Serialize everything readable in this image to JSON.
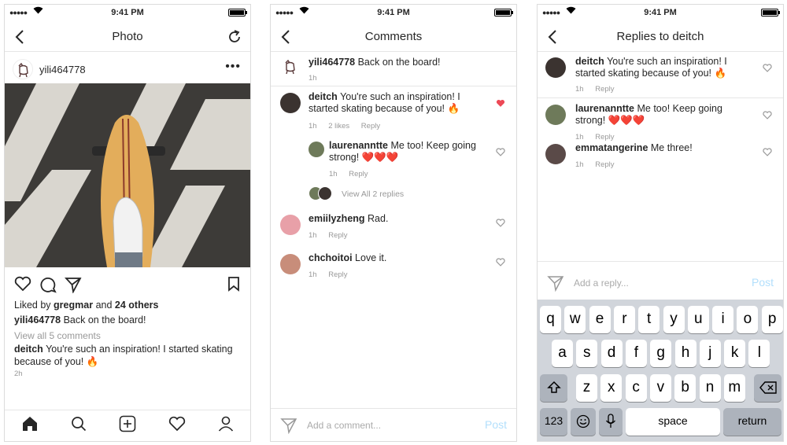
{
  "status": {
    "time": "9:41 PM"
  },
  "photo_screen": {
    "title": "Photo",
    "username": "yili464778",
    "liked_by_prefix": "Liked by",
    "liked_by_user": "gregmar",
    "liked_by_and": "and",
    "liked_by_others": "24 others",
    "caption_user": "yili464778",
    "caption_text": "Back on the board!",
    "view_all": "View all 5 comments",
    "comment_user": "deitch",
    "comment_text": "You're such an inspiration! I started skating because of you! 🔥",
    "time": "2h"
  },
  "comments_screen": {
    "title": "Comments",
    "caption": {
      "user": "yili464778",
      "text": "Back on the board!",
      "time": "1h"
    },
    "comments": [
      {
        "user": "deitch",
        "text": "You're such an inspiration! I started skating because of you! 🔥",
        "time": "1h",
        "likes": "2 likes",
        "reply": "Reply",
        "liked": true
      },
      {
        "user": "laurenanntte",
        "text": "Me too! Keep going strong! ❤️❤️❤️",
        "time": "1h",
        "reply": "Reply"
      },
      {
        "user": "emiilyzheng",
        "text": "Rad.",
        "time": "1h",
        "reply": "Reply"
      },
      {
        "user": "chchoitoi",
        "text": "Love it.",
        "time": "1h",
        "reply": "Reply"
      }
    ],
    "view_replies": "View All 2 replies",
    "input_placeholder": "Add a comment...",
    "post": "Post"
  },
  "replies_screen": {
    "title": "Replies to deitch",
    "replies": [
      {
        "user": "deitch",
        "text": "You're such an inspiration! I started skating because of you! 🔥",
        "time": "1h",
        "reply": "Reply"
      },
      {
        "user": "laurenanntte",
        "text": "Me too! Keep going strong! ❤️❤️❤️",
        "time": "1h",
        "reply": "Reply"
      },
      {
        "user": "emmatangerine",
        "text": "Me three!",
        "time": "1h",
        "reply": "Reply"
      }
    ],
    "input_placeholder": "Add a reply...",
    "post": "Post"
  },
  "keyboard": {
    "row1": [
      "q",
      "w",
      "e",
      "r",
      "t",
      "y",
      "u",
      "i",
      "o",
      "p"
    ],
    "row2": [
      "a",
      "s",
      "d",
      "f",
      "g",
      "h",
      "j",
      "k",
      "l"
    ],
    "row3": [
      "z",
      "x",
      "c",
      "v",
      "b",
      "n",
      "m"
    ],
    "numbers": "123",
    "space": "space",
    "return": "return"
  },
  "colors": {
    "accent_post": "#b2dffc",
    "heart_liked": "#ed4956",
    "keyboard_bg": "#d1d5db"
  }
}
